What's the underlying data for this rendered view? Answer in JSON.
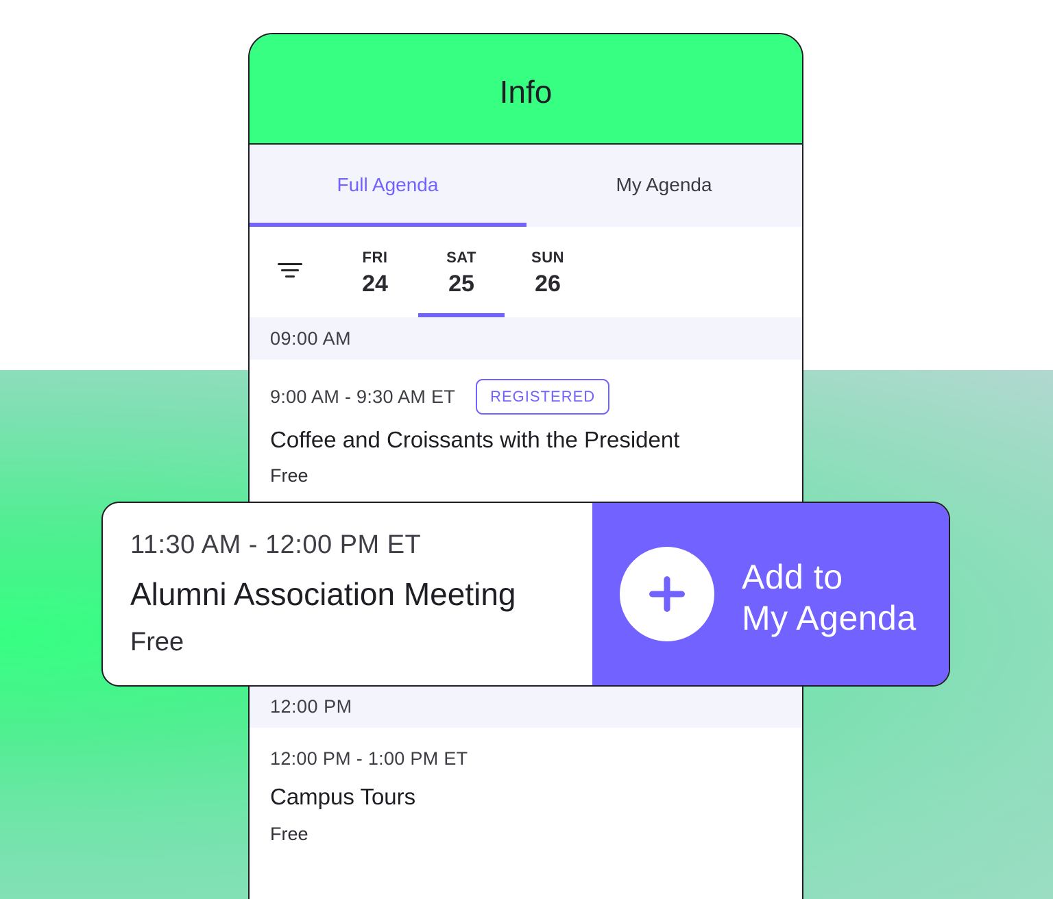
{
  "header": {
    "title": "Info"
  },
  "tabs": [
    {
      "label": "Full Agenda",
      "active": true
    },
    {
      "label": "My Agenda",
      "active": false
    }
  ],
  "days": [
    {
      "name": "FRI",
      "num": "24"
    },
    {
      "name": "SAT",
      "num": "25",
      "selected": true
    },
    {
      "name": "SUN",
      "num": "26"
    }
  ],
  "slots": [
    {
      "label": "09:00 AM",
      "sessions": [
        {
          "time": "9:00 AM - 9:30 AM ET",
          "badge": "REGISTERED",
          "title": "Coffee and Croissants with the President",
          "price": "Free"
        }
      ]
    },
    {
      "label": "12:00 PM",
      "sessions": [
        {
          "time": "12:00 PM - 1:00 PM ET",
          "title": "Campus Tours",
          "price": "Free"
        }
      ]
    }
  ],
  "popup": {
    "time": "11:30 AM - 12:00 PM ET",
    "title": "Alumni Association Meeting",
    "price": "Free",
    "action_line1": "Add to",
    "action_line2": "My Agenda",
    "icon": "plus-icon"
  },
  "colors": {
    "accent": "#7262ff",
    "header_green": "#36ff82",
    "tab_bg": "#f4f4fd",
    "border": "#1e1e24"
  }
}
